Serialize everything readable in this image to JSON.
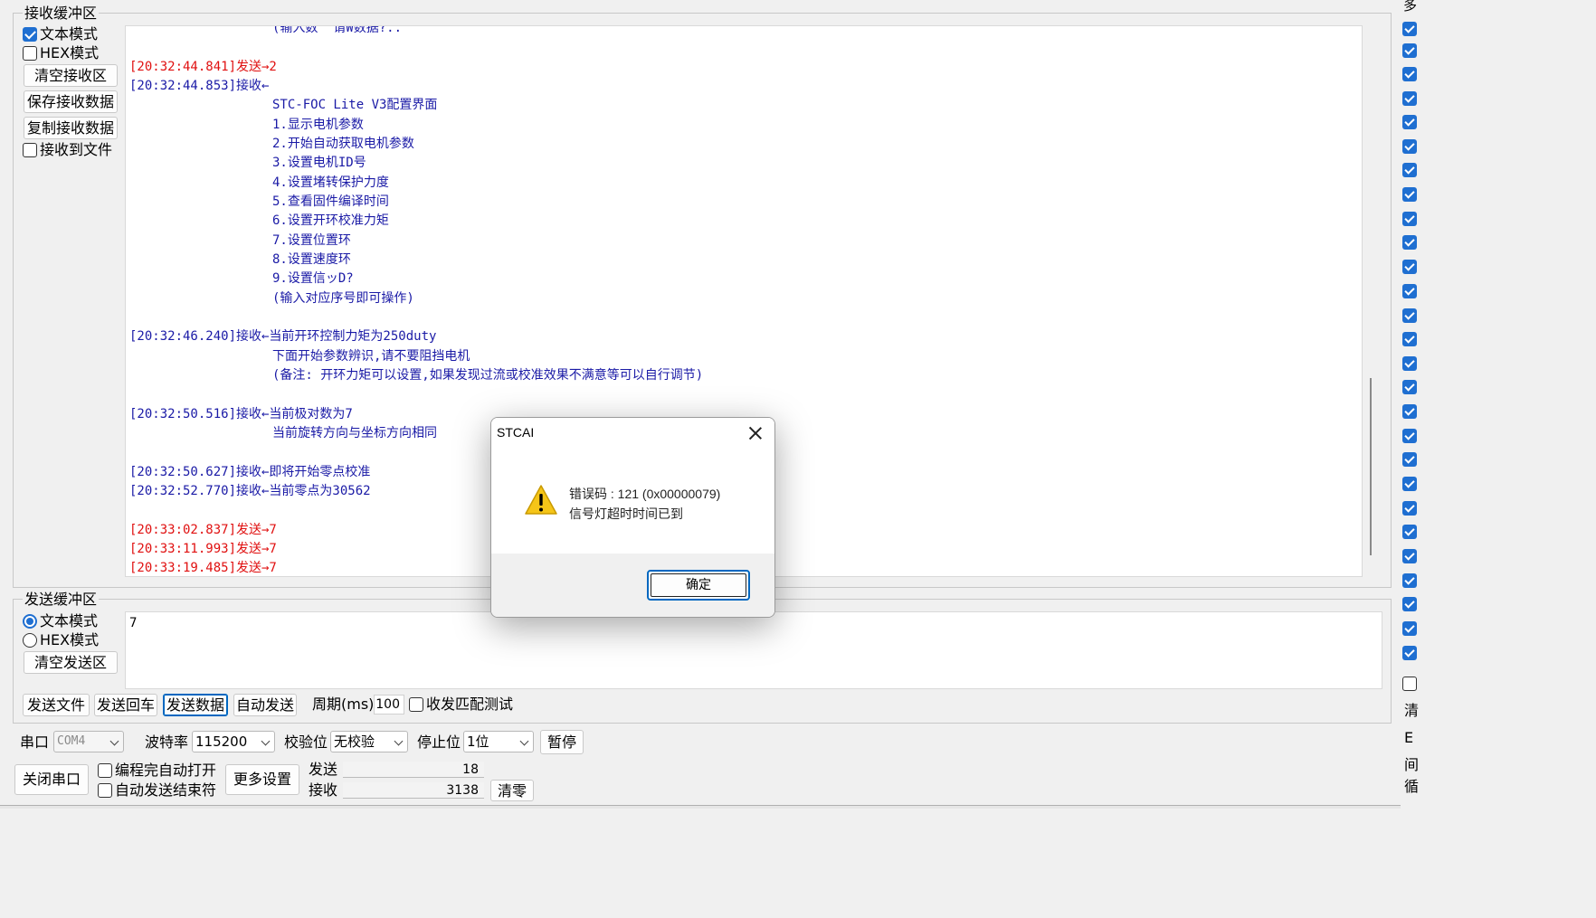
{
  "receive": {
    "title": "接收缓冲区",
    "text_mode": "文本模式",
    "hex_mode": "HEX模式",
    "clear_btn": "清空接收区",
    "save_btn": "保存接收数据",
    "copy_btn": "复制接收数据",
    "to_file": "接收到文件",
    "lines": [
      {
        "kind": "body",
        "text": "(输入数  请W数据?.."
      },
      {
        "kind": "send",
        "text": "[20:32:44.841]发送→2"
      },
      {
        "kind": "recv",
        "text": "[20:32:44.853]接收←"
      },
      {
        "kind": "body",
        "text": "STC-FOC Lite V3配置界面"
      },
      {
        "kind": "body",
        "text": "1.显示电机参数"
      },
      {
        "kind": "body",
        "text": "2.开始自动获取电机参数"
      },
      {
        "kind": "body",
        "text": "3.设置电机ID号"
      },
      {
        "kind": "body",
        "text": "4.设置堵转保护力度"
      },
      {
        "kind": "body",
        "text": "5.查看固件编译时间"
      },
      {
        "kind": "body",
        "text": "6.设置开环校准力矩"
      },
      {
        "kind": "body",
        "text": "7.设置位置环"
      },
      {
        "kind": "body",
        "text": "8.设置速度环"
      },
      {
        "kind": "body",
        "text": "9.设置信ッD?"
      },
      {
        "kind": "body",
        "text": "(输入对应序号即可操作)"
      },
      {
        "kind": "recv",
        "text": "[20:32:46.240]接收←当前开环控制力矩为250duty"
      },
      {
        "kind": "body",
        "text": "下面开始参数辨识,请不要阻挡电机"
      },
      {
        "kind": "body",
        "text": "(备注: 开环力矩可以设置,如果发现过流或校准效果不满意等可以自行调节)"
      },
      {
        "kind": "recv",
        "text": "[20:32:50.516]接收←当前极对数为7"
      },
      {
        "kind": "body",
        "text": "当前旋转方向与坐标方向相同"
      },
      {
        "kind": "recv",
        "text": "[20:32:50.627]接收←即将开始零点校准"
      },
      {
        "kind": "recv",
        "text": "[20:32:52.770]接收←当前零点为30562"
      },
      {
        "kind": "send",
        "text": "[20:33:02.837]发送→7"
      },
      {
        "kind": "send",
        "text": "[20:33:11.993]发送→7"
      },
      {
        "kind": "send",
        "text": "[20:33:19.485]发送→7"
      }
    ]
  },
  "send": {
    "title": "发送缓冲区",
    "text_mode": "文本模式",
    "hex_mode": "HEX模式",
    "clear_btn": "清空发送区",
    "content": "7",
    "send_file": "发送文件",
    "send_enter": "发送回车",
    "send_data": "发送数据",
    "auto_send": "自动发送",
    "period_label": "周期(ms)",
    "period_value": "100",
    "match_test": "收发匹配测试"
  },
  "port": {
    "port_label": "串口",
    "port_value": "COM4",
    "baud_label": "波特率",
    "baud_value": "115200",
    "parity_label": "校验位",
    "parity_value": "无校验",
    "stop_label": "停止位",
    "stop_value": "1位",
    "pause_btn": "暂停",
    "close_btn": "关闭串口",
    "auto_open": "编程完自动打开",
    "auto_end": "自动发送结束符",
    "more_btn": "更多设置",
    "sent_label": "发送",
    "sent_count": "18",
    "recv_label": "接收",
    "recv_count": "3138",
    "reset_btn": "清零"
  },
  "right_strip": {
    "top_char": "多",
    "bottom_chars": [
      "清",
      "E",
      "间",
      "循"
    ]
  },
  "dialog": {
    "title": "STCAI",
    "line1": "错误码 : 121 (0x00000079)",
    "line2": "信号灯超时时间已到",
    "ok": "确定",
    "icon": "warning-icon"
  }
}
